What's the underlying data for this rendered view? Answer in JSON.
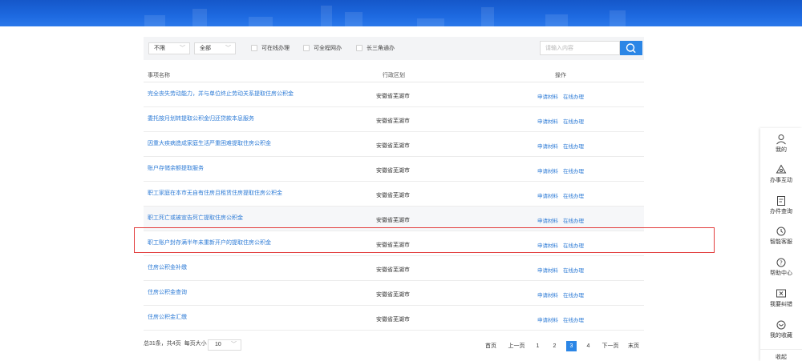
{
  "filters": {
    "scope_select": "不限",
    "type_select": "全部",
    "checkboxes": [
      "可在线办理",
      "可全程网办",
      "长三角通办"
    ],
    "search_placeholder": "请输入内容"
  },
  "table": {
    "headers": [
      "事项名称",
      "行政区划",
      "操作"
    ],
    "rows": [
      {
        "name": "完全丧失劳动能力，并与单位终止劳动关系提取住房公积金",
        "region": "安徽省芜湖市",
        "op1": "申请材料",
        "op2": "在线办理"
      },
      {
        "name": "委托按月划转提取公积金归还贷款本息服务",
        "region": "安徽省芜湖市",
        "op1": "申请材料",
        "op2": "在线办理"
      },
      {
        "name": "因重大疾病造成家庭生活严重困难提取住房公积金",
        "region": "安徽省芜湖市",
        "op1": "申请材料",
        "op2": "在线办理"
      },
      {
        "name": "账户存储余额提取服务",
        "region": "安徽省芜湖市",
        "op1": "申请材料",
        "op2": "在线办理"
      },
      {
        "name": "职工家庭在本市无自有住房且租赁住房提取住房公积金",
        "region": "安徽省芜湖市",
        "op1": "申请材料",
        "op2": "在线办理"
      },
      {
        "name": "职工死亡或被宣告死亡提取住房公积金",
        "region": "安徽省芜湖市",
        "op1": "申请材料",
        "op2": "在线办理"
      },
      {
        "name": "职工账户封存满半年未重新开户的提取住房公积金",
        "region": "安徽省芜湖市",
        "op1": "申请材料",
        "op2": "在线办理"
      },
      {
        "name": "住房公积金补缴",
        "region": "安徽省芜湖市",
        "op1": "申请材料",
        "op2": "在线办理"
      },
      {
        "name": "住房公积金查询",
        "region": "安徽省芜湖市",
        "op1": "申请材料",
        "op2": "在线办理"
      },
      {
        "name": "住房公积金汇缴",
        "region": "安徽省芜湖市",
        "op1": "申请材料",
        "op2": "在线办理"
      }
    ]
  },
  "pagination": {
    "summary": "总31条，共4页",
    "page_size_label": "每页大小",
    "page_size": "10",
    "first": "首页",
    "prev": "上一页",
    "pages": [
      "1",
      "2",
      "3",
      "4"
    ],
    "current_page": "3",
    "next": "下一页",
    "last": "末页"
  },
  "side_rail": {
    "items": [
      {
        "label": "我的",
        "icon": "user-icon"
      },
      {
        "label": "办事互动",
        "icon": "chat-icon"
      },
      {
        "label": "办件查询",
        "icon": "document-search-icon"
      },
      {
        "label": "智能客服",
        "icon": "robot-icon"
      },
      {
        "label": "帮助中心",
        "icon": "help-icon"
      },
      {
        "label": "我要纠错",
        "icon": "error-report-icon"
      },
      {
        "label": "我的收藏",
        "icon": "favorite-icon"
      }
    ],
    "collapse": "收起"
  },
  "colors": {
    "banner": "#1d69e0",
    "link": "#2d7bd6",
    "accent": "#2b86e6",
    "highlight": "#e23c3c"
  }
}
